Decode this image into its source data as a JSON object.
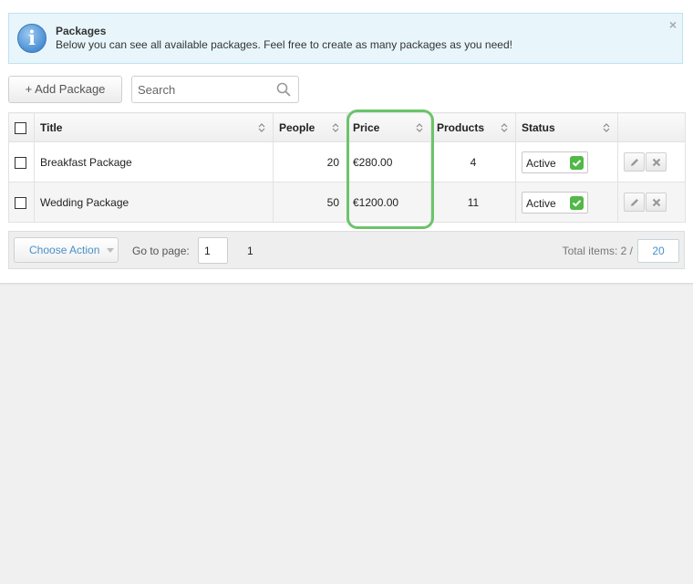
{
  "info": {
    "title": "Packages",
    "text": "Below you can see all available packages. Feel free to create as many packages as you need!",
    "close": "×",
    "icon_glyph": "i",
    "icon": "info-icon"
  },
  "toolbar": {
    "add_label": "+ Add Package",
    "search_placeholder": "Search"
  },
  "table": {
    "columns": [
      "Title",
      "People",
      "Price",
      "Products",
      "Status"
    ],
    "rows": [
      {
        "title": "Breakfast Package",
        "people": "20",
        "price": "€280.00",
        "products": "4",
        "status": "Active"
      },
      {
        "title": "Wedding Package",
        "people": "50",
        "price": "€1200.00",
        "products": "11",
        "status": "Active"
      }
    ]
  },
  "footer": {
    "choose_action": "Choose Action",
    "goto_label": "Go to page:",
    "goto_value": "1",
    "page": "1",
    "total_label": "Total items: 2 /",
    "per_page": "20"
  },
  "colors": {
    "highlight": "#6cc46a",
    "info_bg": "#e8f6fc",
    "active_check": "#52b848",
    "link_blue": "#4a90c8"
  }
}
